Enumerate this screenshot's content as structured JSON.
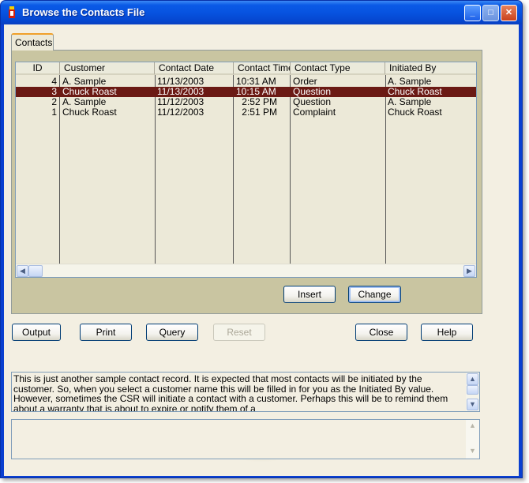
{
  "window": {
    "title": "Browse the Contacts File",
    "minimize_glyph": "_",
    "maximize_glyph": "□",
    "close_glyph": "✕"
  },
  "tabs": [
    {
      "label": "Contacts"
    }
  ],
  "list": {
    "columns": [
      {
        "label": "ID"
      },
      {
        "label": "Customer"
      },
      {
        "label": "Contact Date"
      },
      {
        "label": "Contact Time"
      },
      {
        "label": "Contact Type"
      },
      {
        "label": "Initiated By"
      }
    ],
    "rows": [
      {
        "id": "4",
        "customer": "A. Sample",
        "date": "11/13/2003",
        "time": "10:31 AM",
        "type": "Order",
        "initiated_by": "A. Sample",
        "selected": false
      },
      {
        "id": "3",
        "customer": "Chuck Roast",
        "date": "11/13/2003",
        "time": "10:15 AM",
        "type": "Question",
        "initiated_by": "Chuck Roast",
        "selected": true
      },
      {
        "id": "2",
        "customer": "A. Sample",
        "date": "11/12/2003",
        "time": "2:52 PM",
        "type": "Question",
        "initiated_by": "A. Sample",
        "selected": false
      },
      {
        "id": "1",
        "customer": "Chuck Roast",
        "date": "11/12/2003",
        "time": "2:51 PM",
        "type": "Complaint",
        "initiated_by": "Chuck Roast",
        "selected": false
      }
    ]
  },
  "panel_buttons": {
    "insert": "Insert",
    "change": "Change"
  },
  "toolbar": {
    "output": "Output",
    "print": "Print",
    "query": "Query",
    "reset": "Reset",
    "close": "Close",
    "help": "Help"
  },
  "notes": {
    "text": "This is just another sample contact record.  It is expected that most contacts will be initiated by the customer.  So, when you select a customer name this will be filled in for you as the Initiated By  value.  However, sometimes the CSR will initiate a contact with a customer.  Perhaps this will be to remind them about a warranty that is about to expire or notify them of a",
    "value": ""
  },
  "icons": {
    "scroll_left": "◀",
    "scroll_right": "▶",
    "scroll_up": "▲",
    "scroll_down": "▼"
  },
  "colors": {
    "selection": "#6b1a14",
    "title_bar": "#0753e0",
    "panel": "#c9c5a1"
  }
}
